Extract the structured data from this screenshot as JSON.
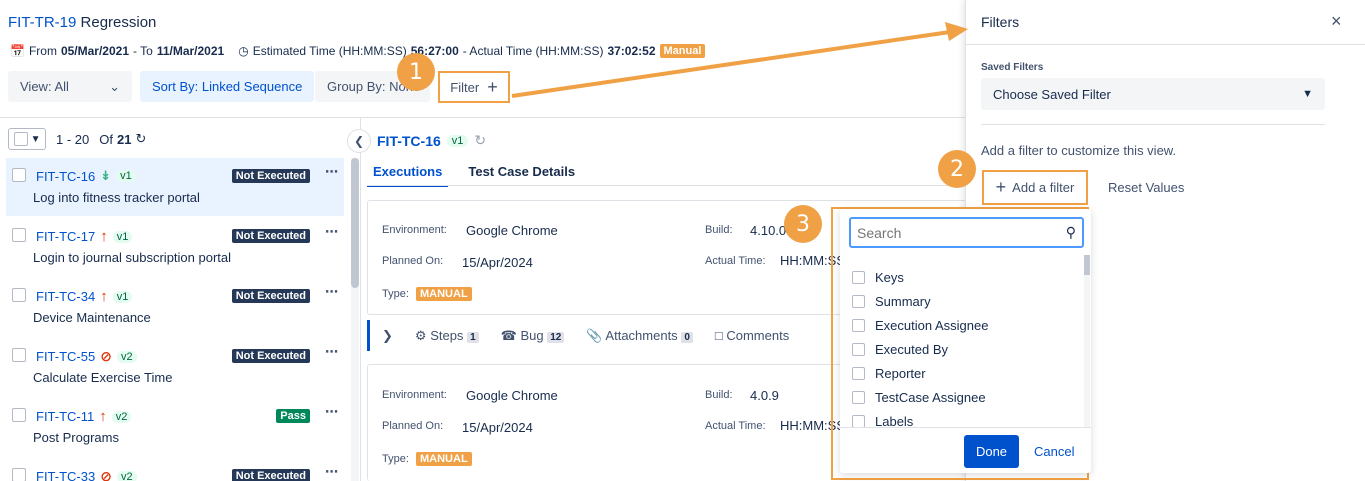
{
  "header": {
    "test_run_key": "FIT-TR-19",
    "test_run_name": "Regression",
    "from_label": "From",
    "from_date": "05/Mar/2021",
    "to_label": "- To",
    "to_date": "11/Mar/2021",
    "estimated_label": "Estimated Time (HH:MM:SS)",
    "estimated_value": "56:27:00",
    "actual_label": "- Actual Time (HH:MM:SS)",
    "actual_value": "37:02:52",
    "type_badge": "Manual"
  },
  "toolbar": {
    "view": "View: All",
    "sort": "Sort By: Linked Sequence",
    "group": "Group By: None",
    "filter": "Filter",
    "filter_plus": "+"
  },
  "list": {
    "range": "1 - 20",
    "of_label": "Of",
    "total": "21",
    "items": [
      {
        "key": "FIT-TC-16",
        "ver": "v1",
        "name": "Log into fitness tracker portal",
        "status": "Not Executed",
        "priority": "low"
      },
      {
        "key": "FIT-TC-17",
        "ver": "v1",
        "name": "Login to journal subscription portal",
        "status": "Not Executed",
        "priority": "high"
      },
      {
        "key": "FIT-TC-34",
        "ver": "v1",
        "name": "Device Maintenance",
        "status": "Not Executed",
        "priority": "high"
      },
      {
        "key": "FIT-TC-55",
        "ver": "v2",
        "name": "Calculate Exercise Time",
        "status": "Not Executed",
        "priority": "blocker"
      },
      {
        "key": "FIT-TC-11",
        "ver": "v2",
        "name": "Post Programs",
        "status": "Pass",
        "priority": "high"
      },
      {
        "key": "FIT-TC-33",
        "ver": "v2",
        "name": "",
        "status": "Not Executed",
        "priority": "blocker"
      }
    ]
  },
  "detail": {
    "key": "FIT-TC-16",
    "ver": "v1",
    "tabs": [
      "Executions",
      "Test Case Details"
    ],
    "executions": [
      {
        "env_label": "Environment:",
        "env": "Google Chrome",
        "build_label": "Build:",
        "build": "4.10.0",
        "planned_label": "Planned On:",
        "planned": "15/Apr/2024",
        "actual_label": "Actual Time:",
        "actual": "HH:MM:SS",
        "type_label": "Type:",
        "type": "MANUAL"
      },
      {
        "env_label": "Environment:",
        "env": "Google Chrome",
        "build_label": "Build:",
        "build": "4.0.9",
        "planned_label": "Planned On:",
        "planned": "15/Apr/2024",
        "actual_label": "Actual Time:",
        "actual": "HH:MM:SS",
        "type_label": "Type:",
        "type": "MANUAL"
      }
    ],
    "actions": {
      "steps": "Steps",
      "steps_count": "1",
      "bug": "Bug",
      "bug_count": "12",
      "attachments": "Attachments",
      "attachments_count": "0",
      "comments": "Comments"
    }
  },
  "drawer": {
    "title": "Filters",
    "close": "×",
    "saved_label": "Saved Filters",
    "saved_placeholder": "Choose Saved Filter",
    "hint": "Add a filter to customize this view.",
    "add_filter": "Add a filter",
    "add_plus": "+",
    "reset": "Reset Values"
  },
  "dropdown": {
    "search_placeholder": "Search",
    "options": [
      "Keys",
      "Summary",
      "Execution Assignee",
      "Executed By",
      "Reporter",
      "TestCase Assignee",
      "Labels"
    ],
    "done": "Done",
    "cancel": "Cancel"
  },
  "callouts": [
    "1",
    "2",
    "3"
  ],
  "colors": {
    "accent": "#0052cc",
    "callout": "#f0a045",
    "not_executed": "#253858",
    "pass": "#00875a"
  }
}
